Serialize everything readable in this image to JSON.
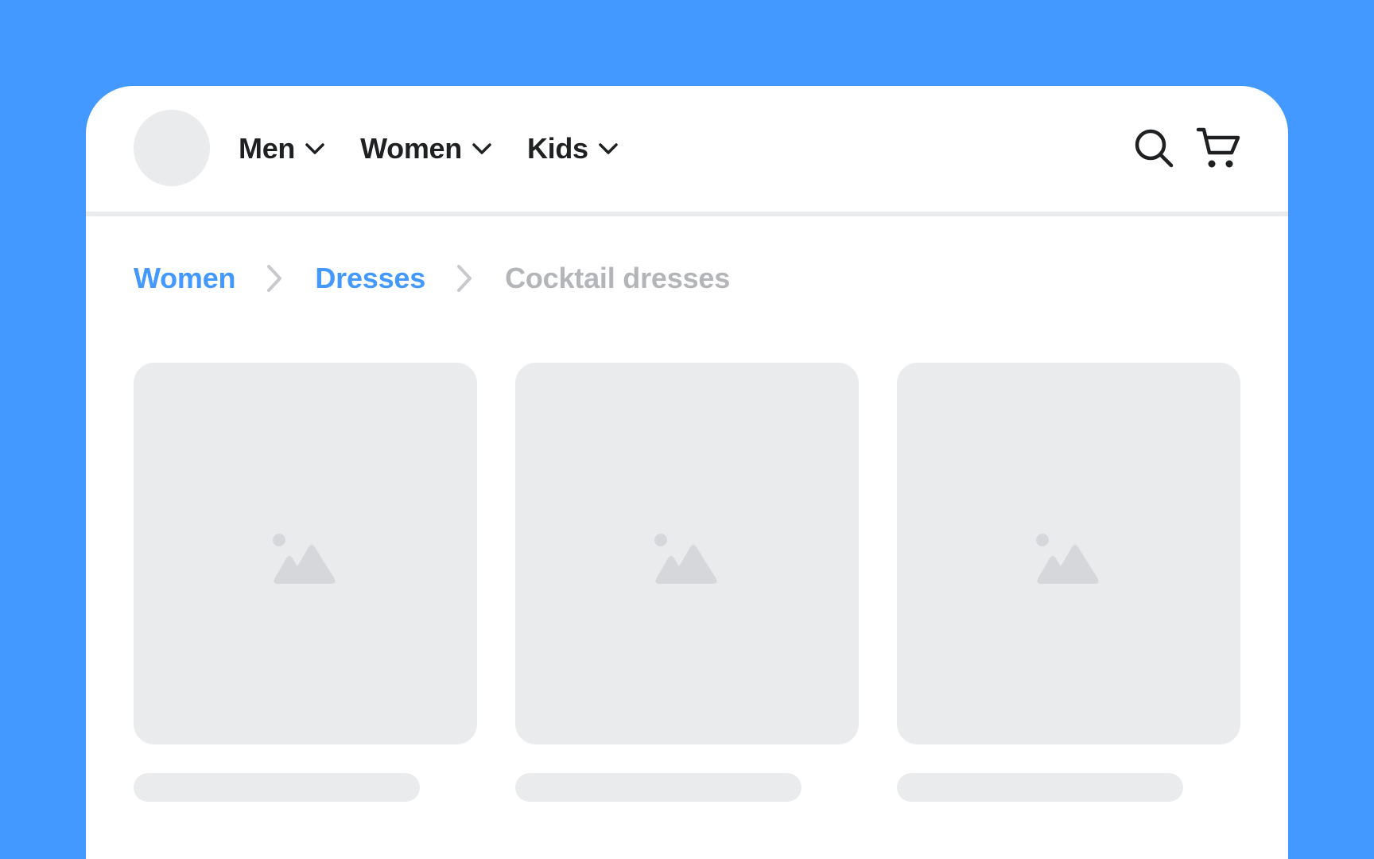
{
  "nav": {
    "items": [
      {
        "label": "Men",
        "icon": "chevron-down-icon"
      },
      {
        "label": "Women",
        "icon": "chevron-down-icon"
      },
      {
        "label": "Kids",
        "icon": "chevron-down-icon"
      }
    ],
    "actions": {
      "search_icon": "search-icon",
      "cart_icon": "cart-icon"
    }
  },
  "breadcrumb": {
    "items": [
      {
        "label": "Women"
      },
      {
        "label": "Dresses"
      },
      {
        "label": "Cocktail dresses"
      }
    ],
    "separator_icon": "chevron-right-icon"
  },
  "products": {
    "placeholder_icon": "image-placeholder-icon",
    "count": 3
  },
  "colors": {
    "background": "#4399FF",
    "accent": "#4399FF",
    "text": "#1E2022",
    "muted": "#B3B5B9",
    "placeholder": "#EAEBED"
  }
}
